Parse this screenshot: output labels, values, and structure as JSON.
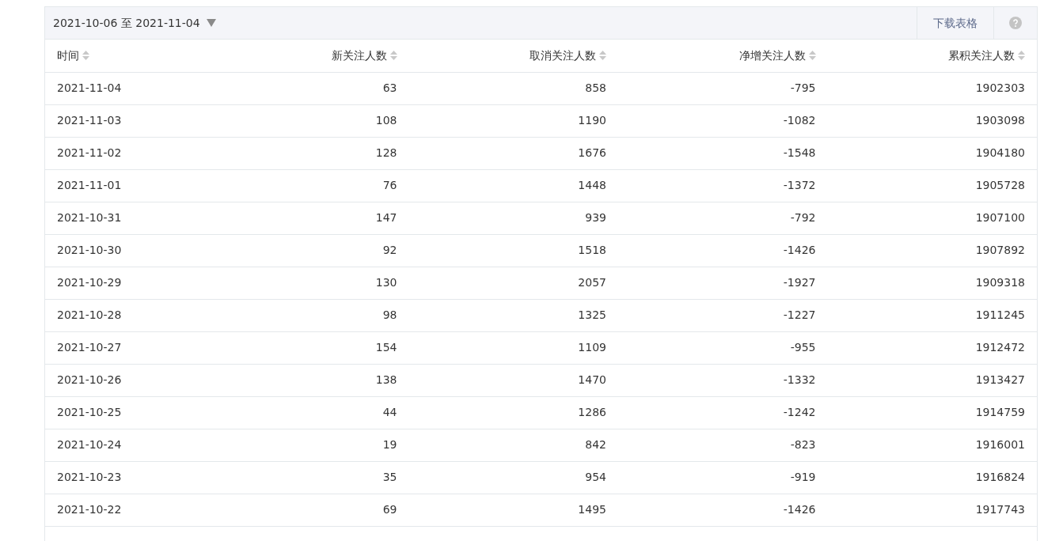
{
  "toolbar": {
    "date_range": "2021-10-06 至 2021-11-04",
    "download_label": "下载表格"
  },
  "table": {
    "columns": [
      "时间",
      "新关注人数",
      "取消关注人数",
      "净增关注人数",
      "累积关注人数"
    ],
    "rows": [
      [
        "2021-11-04",
        "63",
        "858",
        "-795",
        "1902303"
      ],
      [
        "2021-11-03",
        "108",
        "1190",
        "-1082",
        "1903098"
      ],
      [
        "2021-11-02",
        "128",
        "1676",
        "-1548",
        "1904180"
      ],
      [
        "2021-11-01",
        "76",
        "1448",
        "-1372",
        "1905728"
      ],
      [
        "2021-10-31",
        "147",
        "939",
        "-792",
        "1907100"
      ],
      [
        "2021-10-30",
        "92",
        "1518",
        "-1426",
        "1907892"
      ],
      [
        "2021-10-29",
        "130",
        "2057",
        "-1927",
        "1909318"
      ],
      [
        "2021-10-28",
        "98",
        "1325",
        "-1227",
        "1911245"
      ],
      [
        "2021-10-27",
        "154",
        "1109",
        "-955",
        "1912472"
      ],
      [
        "2021-10-26",
        "138",
        "1470",
        "-1332",
        "1913427"
      ],
      [
        "2021-10-25",
        "44",
        "1286",
        "-1242",
        "1914759"
      ],
      [
        "2021-10-24",
        "19",
        "842",
        "-823",
        "1916001"
      ],
      [
        "2021-10-23",
        "35",
        "954",
        "-919",
        "1916824"
      ],
      [
        "2021-10-22",
        "69",
        "1495",
        "-1426",
        "1917743"
      ]
    ]
  }
}
